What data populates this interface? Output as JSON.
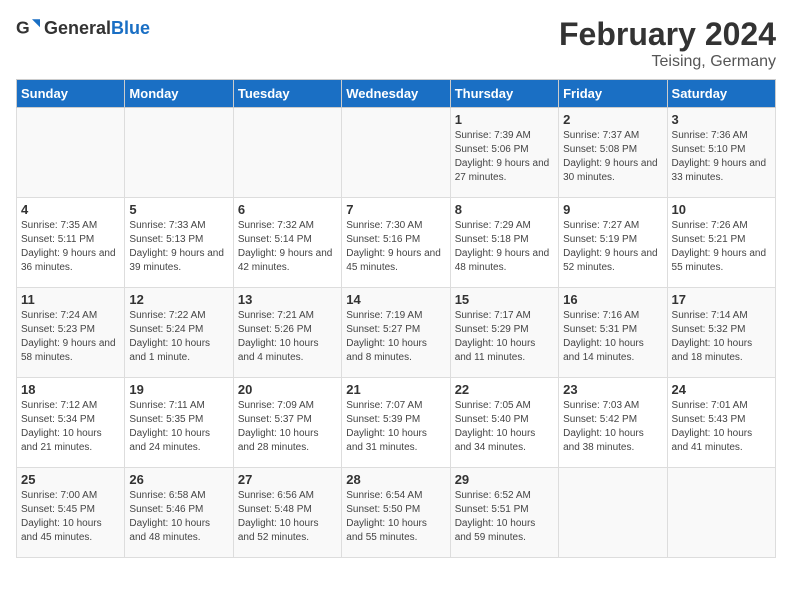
{
  "header": {
    "logo_general": "General",
    "logo_blue": "Blue",
    "month": "February 2024",
    "location": "Teising, Germany"
  },
  "weekdays": [
    "Sunday",
    "Monday",
    "Tuesday",
    "Wednesday",
    "Thursday",
    "Friday",
    "Saturday"
  ],
  "weeks": [
    [
      {
        "day": "",
        "sunrise": "",
        "sunset": "",
        "daylight": ""
      },
      {
        "day": "",
        "sunrise": "",
        "sunset": "",
        "daylight": ""
      },
      {
        "day": "",
        "sunrise": "",
        "sunset": "",
        "daylight": ""
      },
      {
        "day": "",
        "sunrise": "",
        "sunset": "",
        "daylight": ""
      },
      {
        "day": "1",
        "sunrise": "Sunrise: 7:39 AM",
        "sunset": "Sunset: 5:06 PM",
        "daylight": "Daylight: 9 hours and 27 minutes."
      },
      {
        "day": "2",
        "sunrise": "Sunrise: 7:37 AM",
        "sunset": "Sunset: 5:08 PM",
        "daylight": "Daylight: 9 hours and 30 minutes."
      },
      {
        "day": "3",
        "sunrise": "Sunrise: 7:36 AM",
        "sunset": "Sunset: 5:10 PM",
        "daylight": "Daylight: 9 hours and 33 minutes."
      }
    ],
    [
      {
        "day": "4",
        "sunrise": "Sunrise: 7:35 AM",
        "sunset": "Sunset: 5:11 PM",
        "daylight": "Daylight: 9 hours and 36 minutes."
      },
      {
        "day": "5",
        "sunrise": "Sunrise: 7:33 AM",
        "sunset": "Sunset: 5:13 PM",
        "daylight": "Daylight: 9 hours and 39 minutes."
      },
      {
        "day": "6",
        "sunrise": "Sunrise: 7:32 AM",
        "sunset": "Sunset: 5:14 PM",
        "daylight": "Daylight: 9 hours and 42 minutes."
      },
      {
        "day": "7",
        "sunrise": "Sunrise: 7:30 AM",
        "sunset": "Sunset: 5:16 PM",
        "daylight": "Daylight: 9 hours and 45 minutes."
      },
      {
        "day": "8",
        "sunrise": "Sunrise: 7:29 AM",
        "sunset": "Sunset: 5:18 PM",
        "daylight": "Daylight: 9 hours and 48 minutes."
      },
      {
        "day": "9",
        "sunrise": "Sunrise: 7:27 AM",
        "sunset": "Sunset: 5:19 PM",
        "daylight": "Daylight: 9 hours and 52 minutes."
      },
      {
        "day": "10",
        "sunrise": "Sunrise: 7:26 AM",
        "sunset": "Sunset: 5:21 PM",
        "daylight": "Daylight: 9 hours and 55 minutes."
      }
    ],
    [
      {
        "day": "11",
        "sunrise": "Sunrise: 7:24 AM",
        "sunset": "Sunset: 5:23 PM",
        "daylight": "Daylight: 9 hours and 58 minutes."
      },
      {
        "day": "12",
        "sunrise": "Sunrise: 7:22 AM",
        "sunset": "Sunset: 5:24 PM",
        "daylight": "Daylight: 10 hours and 1 minute."
      },
      {
        "day": "13",
        "sunrise": "Sunrise: 7:21 AM",
        "sunset": "Sunset: 5:26 PM",
        "daylight": "Daylight: 10 hours and 4 minutes."
      },
      {
        "day": "14",
        "sunrise": "Sunrise: 7:19 AM",
        "sunset": "Sunset: 5:27 PM",
        "daylight": "Daylight: 10 hours and 8 minutes."
      },
      {
        "day": "15",
        "sunrise": "Sunrise: 7:17 AM",
        "sunset": "Sunset: 5:29 PM",
        "daylight": "Daylight: 10 hours and 11 minutes."
      },
      {
        "day": "16",
        "sunrise": "Sunrise: 7:16 AM",
        "sunset": "Sunset: 5:31 PM",
        "daylight": "Daylight: 10 hours and 14 minutes."
      },
      {
        "day": "17",
        "sunrise": "Sunrise: 7:14 AM",
        "sunset": "Sunset: 5:32 PM",
        "daylight": "Daylight: 10 hours and 18 minutes."
      }
    ],
    [
      {
        "day": "18",
        "sunrise": "Sunrise: 7:12 AM",
        "sunset": "Sunset: 5:34 PM",
        "daylight": "Daylight: 10 hours and 21 minutes."
      },
      {
        "day": "19",
        "sunrise": "Sunrise: 7:11 AM",
        "sunset": "Sunset: 5:35 PM",
        "daylight": "Daylight: 10 hours and 24 minutes."
      },
      {
        "day": "20",
        "sunrise": "Sunrise: 7:09 AM",
        "sunset": "Sunset: 5:37 PM",
        "daylight": "Daylight: 10 hours and 28 minutes."
      },
      {
        "day": "21",
        "sunrise": "Sunrise: 7:07 AM",
        "sunset": "Sunset: 5:39 PM",
        "daylight": "Daylight: 10 hours and 31 minutes."
      },
      {
        "day": "22",
        "sunrise": "Sunrise: 7:05 AM",
        "sunset": "Sunset: 5:40 PM",
        "daylight": "Daylight: 10 hours and 34 minutes."
      },
      {
        "day": "23",
        "sunrise": "Sunrise: 7:03 AM",
        "sunset": "Sunset: 5:42 PM",
        "daylight": "Daylight: 10 hours and 38 minutes."
      },
      {
        "day": "24",
        "sunrise": "Sunrise: 7:01 AM",
        "sunset": "Sunset: 5:43 PM",
        "daylight": "Daylight: 10 hours and 41 minutes."
      }
    ],
    [
      {
        "day": "25",
        "sunrise": "Sunrise: 7:00 AM",
        "sunset": "Sunset: 5:45 PM",
        "daylight": "Daylight: 10 hours and 45 minutes."
      },
      {
        "day": "26",
        "sunrise": "Sunrise: 6:58 AM",
        "sunset": "Sunset: 5:46 PM",
        "daylight": "Daylight: 10 hours and 48 minutes."
      },
      {
        "day": "27",
        "sunrise": "Sunrise: 6:56 AM",
        "sunset": "Sunset: 5:48 PM",
        "daylight": "Daylight: 10 hours and 52 minutes."
      },
      {
        "day": "28",
        "sunrise": "Sunrise: 6:54 AM",
        "sunset": "Sunset: 5:50 PM",
        "daylight": "Daylight: 10 hours and 55 minutes."
      },
      {
        "day": "29",
        "sunrise": "Sunrise: 6:52 AM",
        "sunset": "Sunset: 5:51 PM",
        "daylight": "Daylight: 10 hours and 59 minutes."
      },
      {
        "day": "",
        "sunrise": "",
        "sunset": "",
        "daylight": ""
      },
      {
        "day": "",
        "sunrise": "",
        "sunset": "",
        "daylight": ""
      }
    ]
  ]
}
